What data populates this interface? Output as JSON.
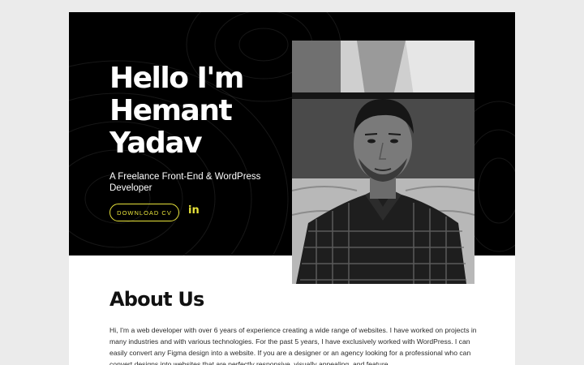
{
  "hero": {
    "title_lines": [
      "Hello I'm",
      "Hemant",
      "Yadav"
    ],
    "subtitle": "A Freelance Front-End & WordPress Developer",
    "cv_button_label": "DOWNLOAD CV",
    "linkedin_label": "in"
  },
  "about": {
    "heading": "About Us",
    "text": "Hi, I'm a web developer with over 6 years of experience creating a wide range of websites. I have worked on projects in many industries and with various technologies. For the past 5 years, I have exclusively worked with WordPress. I can easily convert any Figma design into a website. If you are a designer or an agency looking for a professional who can convert designs into websites that are perfectly responsive, visually appealing, and feature"
  },
  "colors": {
    "hero_background": "#000000",
    "accent": "#e8e33b",
    "page_background": "#ebebeb"
  },
  "icons": [
    "linkedin-icon"
  ]
}
